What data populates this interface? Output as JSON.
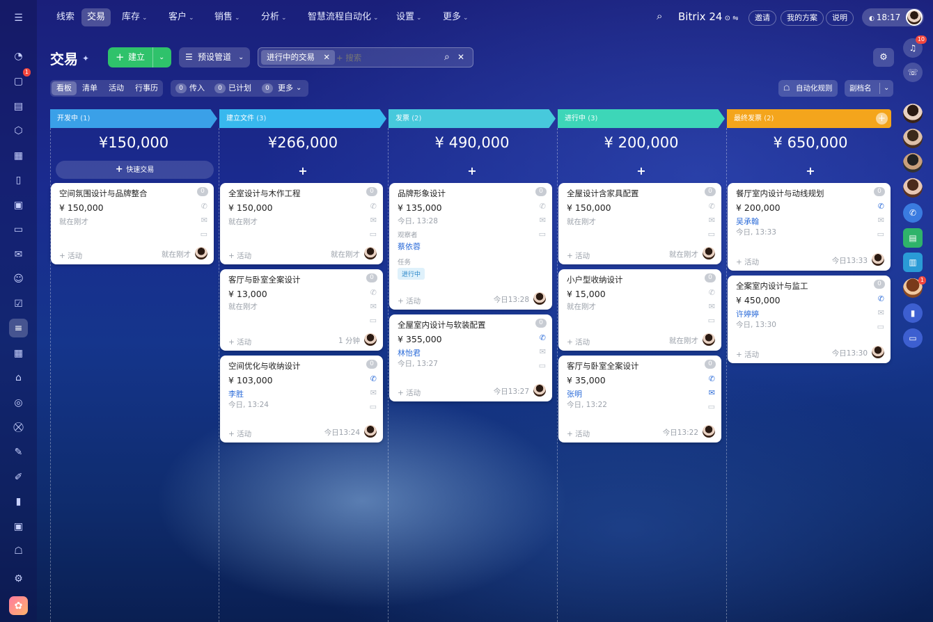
{
  "nav": {
    "items": [
      "线索",
      "交易",
      "库存",
      "客户",
      "销售",
      "分析",
      "智慧流程自动化",
      "设置",
      "更多"
    ],
    "active": "交易"
  },
  "brand": "Bitrix 24",
  "header_buttons": {
    "invite": "邀请",
    "plan": "我的方案",
    "help": "说明",
    "clock": "18:17"
  },
  "page_title": "交易",
  "toolbar": {
    "create": "建立",
    "pipeline": "预设管道",
    "filter_tag": "进行中的交易",
    "search_placeholder": "+ 搜索"
  },
  "view_tabs": [
    "看板",
    "清单",
    "活动",
    "行事历"
  ],
  "counters": [
    {
      "count": "0",
      "label": "传入"
    },
    {
      "count": "0",
      "label": "已计划"
    },
    {
      "count": "0",
      "label": "更多"
    }
  ],
  "automation": "自动化规则",
  "alias": "副档名",
  "quick_deal": "快速交易",
  "columns": [
    {
      "label": "开发中",
      "count": "(1)",
      "total": "¥150,000",
      "color": "#3aa0e8"
    },
    {
      "label": "建立文件",
      "count": "(3)",
      "total": "¥266,000",
      "color": "#38b8ee"
    },
    {
      "label": "发票",
      "count": "(2)",
      "total": "¥ 490,000",
      "color": "#47c9dc"
    },
    {
      "label": "进行中",
      "count": "(3)",
      "total": "¥ 200,000",
      "color": "#3dd6b8"
    },
    {
      "label": "最终发票",
      "count": "(2)",
      "total": "¥ 650,000",
      "color": "#f4a51c"
    }
  ],
  "cards": {
    "c0_0": {
      "title": "空间氛围设计与品牌整合",
      "amount": "¥ 150,000",
      "sub": "就在刚才",
      "count": "0",
      "activity": "+ 活动",
      "time": "就在刚才"
    },
    "c1_0": {
      "title": "全室设计与木作工程",
      "amount": "¥ 150,000",
      "sub": "就在刚才",
      "count": "0",
      "activity": "+ 活动",
      "time": "就在刚才"
    },
    "c1_1": {
      "title": "客厅与卧室全案设计",
      "amount": "¥ 13,000",
      "sub": "就在刚才",
      "count": "0",
      "activity": "+ 活动",
      "time": "1 分钟"
    },
    "c1_2": {
      "title": "空间优化与收纳设计",
      "amount": "¥ 103,000",
      "contact": "李胜",
      "sub": "今日, 13:24",
      "count": "0",
      "activity": "+ 活动",
      "time": "今日13:24"
    },
    "c2_0": {
      "title": "品牌形象设计",
      "amount": "¥ 135,000",
      "sub": "今日, 13:28",
      "observer_label": "观察者",
      "observer": "蔡依蓉",
      "task_label": "任务",
      "task_status": "进行中",
      "count": "0",
      "activity": "+ 活动",
      "time": "今日13:28"
    },
    "c2_1": {
      "title": "全屋室内设计与软装配置",
      "amount": "¥ 355,000",
      "contact": "林怡君",
      "sub": "今日, 13:27",
      "count": "0",
      "activity": "+ 活动",
      "time": "今日13:27"
    },
    "c3_0": {
      "title": "全屋设计含家具配置",
      "amount": "¥ 150,000",
      "sub": "就在刚才",
      "count": "0",
      "activity": "+ 活动",
      "time": "就在刚才"
    },
    "c3_1": {
      "title": "小户型收纳设计",
      "amount": "¥ 15,000",
      "sub": "就在刚才",
      "count": "0",
      "activity": "+ 活动",
      "time": "就在刚才"
    },
    "c3_2": {
      "title": "客厅与卧室全案设计",
      "amount": "¥ 35,000",
      "contact": "张明",
      "sub": "今日, 13:22",
      "count": "0",
      "activity": "+ 活动",
      "time": "今日13:22"
    },
    "c4_0": {
      "title": "餐厅室内设计与动线规划",
      "amount": "¥ 200,000",
      "contact": "吴承翰",
      "sub": "今日, 13:33",
      "count": "0",
      "activity": "+ 活动",
      "time": "今日13:33"
    },
    "c4_1": {
      "title": "全案室内设计与监工",
      "amount": "¥ 450,000",
      "contact": "许婷婷",
      "sub": "今日, 13:30",
      "count": "0",
      "activity": "+ 活动",
      "time": "今日13:30"
    }
  },
  "badges": {
    "chat": "1",
    "notifications": "10",
    "user_count": "1"
  }
}
